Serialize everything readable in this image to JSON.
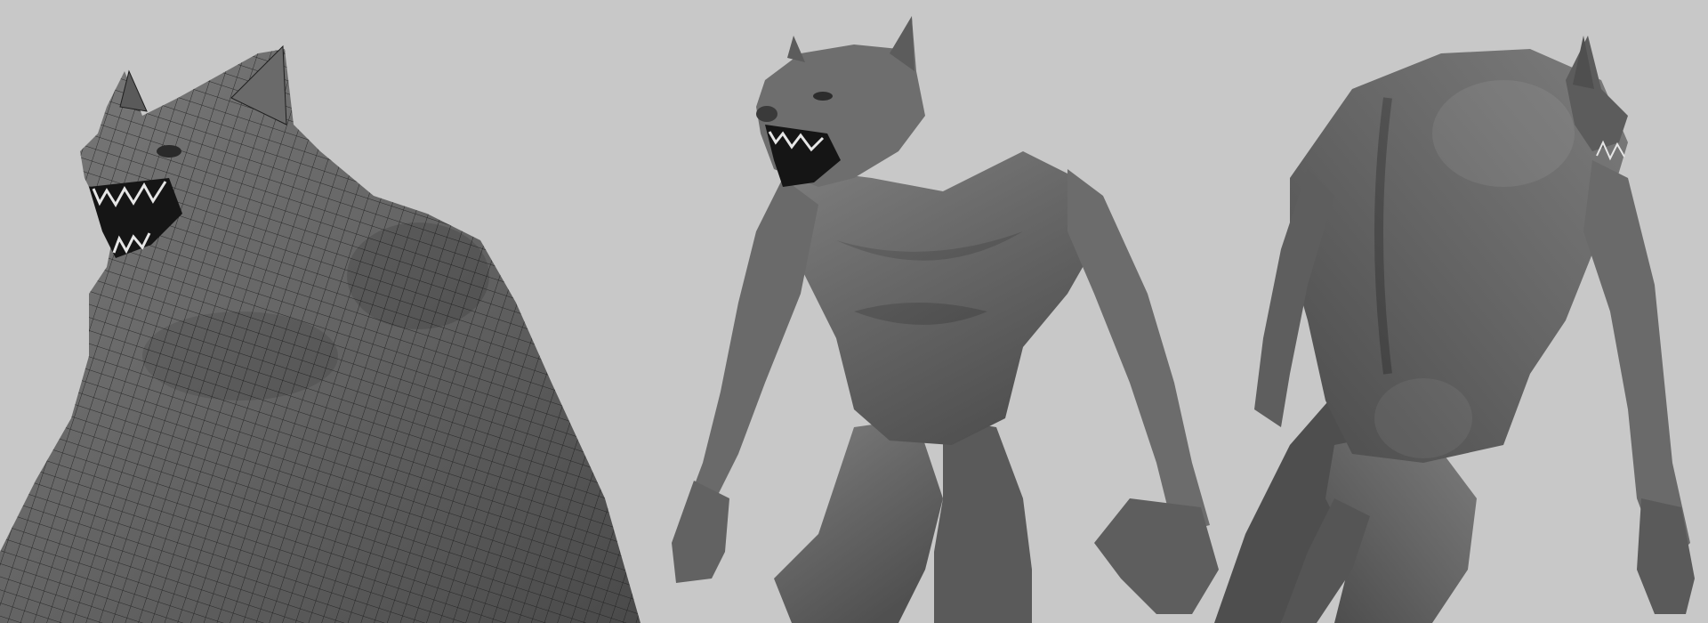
{
  "scene": {
    "background_color": "#c8c8c8",
    "subject": "werewolf-sculpt",
    "views": [
      {
        "id": "wireframe-front-three-quarter",
        "shading": "wireframe-on-shaded"
      },
      {
        "id": "shaded-front",
        "shading": "smooth-shaded"
      },
      {
        "id": "shaded-back-three-quarter",
        "shading": "smooth-shaded"
      }
    ],
    "colors": {
      "mesh_fill": "#6e6e6e",
      "mesh_shadow": "#4a4a4a",
      "mesh_highlight": "#8e8e8e",
      "wire_color": "#1e1e1e",
      "mouth_interior": "#151515",
      "teeth": "#e6e6e6"
    }
  }
}
